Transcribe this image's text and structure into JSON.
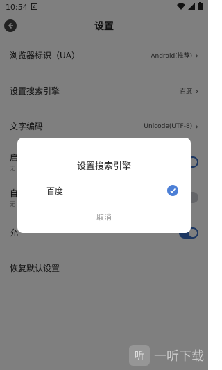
{
  "status_bar": {
    "time": "10:54",
    "notification_icon": "a-icon",
    "wifi_icon": "wifi-icon",
    "signal_icon": "signal-icon",
    "battery_icon": "battery-icon"
  },
  "app_bar": {
    "title": "设置",
    "back_icon": "back-arrow-icon"
  },
  "settings": [
    {
      "label": "浏览器标识（UA）",
      "value": "Android(推荐)"
    },
    {
      "label": "设置搜索引擎",
      "value": "百度"
    },
    {
      "label": "文字编码",
      "value": "Unicode(UTF-8)"
    },
    {
      "label": "启",
      "sub": "无",
      "toggle": true
    },
    {
      "label": "自",
      "sub": "无",
      "toggle": false
    },
    {
      "label": "允",
      "toggle": true
    },
    {
      "label": "恢复默认设置"
    }
  ],
  "dialog": {
    "title": "设置搜索引擎",
    "options": [
      {
        "label": "百度",
        "selected": true
      }
    ],
    "cancel_label": "取消"
  },
  "watermark": {
    "text": "一听下载",
    "logo": "听"
  },
  "colors": {
    "accent": "#4c7fd6",
    "overlay": "rgba(0,0,0,0.5)"
  }
}
